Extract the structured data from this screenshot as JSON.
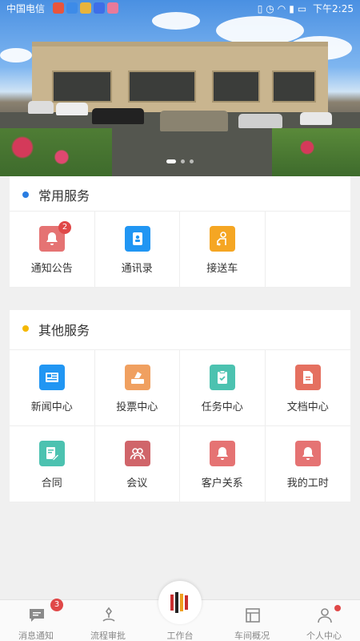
{
  "status_bar": {
    "carrier": "中国电信",
    "time": "下午2:25",
    "icons": [
      "app-icon-1",
      "app-icon-2",
      "app-icon-3",
      "app-icon-4",
      "app-icon-5"
    ]
  },
  "banner": {
    "slides": 3,
    "active_slide": 1
  },
  "common_services": {
    "title": "常用服务",
    "accent": "#2a7de1",
    "items": [
      {
        "label": "通知公告",
        "icon": "bell-icon",
        "color": "#e57373",
        "badge": "2"
      },
      {
        "label": "通讯录",
        "icon": "contacts-icon",
        "color": "#2196f3"
      },
      {
        "label": "接送车",
        "icon": "shuttle-icon",
        "color": "#f5a623"
      }
    ]
  },
  "other_services": {
    "title": "其他服务",
    "accent": "#f5b800",
    "items": [
      {
        "label": "新闻中心",
        "icon": "news-icon",
        "color": "#2196f3"
      },
      {
        "label": "投票中心",
        "icon": "vote-icon",
        "color": "#f0a060"
      },
      {
        "label": "任务中心",
        "icon": "task-icon",
        "color": "#4cc2b0"
      },
      {
        "label": "文档中心",
        "icon": "document-icon",
        "color": "#e57060"
      },
      {
        "label": "合同",
        "icon": "contract-icon",
        "color": "#4cc2b0"
      },
      {
        "label": "会议",
        "icon": "meeting-icon",
        "color": "#d0656a"
      },
      {
        "label": "客户关系",
        "icon": "bell-icon",
        "color": "#e57373"
      },
      {
        "label": "我的工时",
        "icon": "bell-icon",
        "color": "#e57373"
      }
    ]
  },
  "tabbar": {
    "tabs": [
      {
        "label": "消息通知",
        "icon": "message-icon",
        "badge": "3"
      },
      {
        "label": "流程审批",
        "icon": "approval-icon"
      },
      {
        "label": "工作台",
        "icon": "workbench-icon",
        "active": true
      },
      {
        "label": "车间概况",
        "icon": "workshop-icon"
      },
      {
        "label": "个人中心",
        "icon": "person-icon",
        "dot": true
      }
    ]
  }
}
